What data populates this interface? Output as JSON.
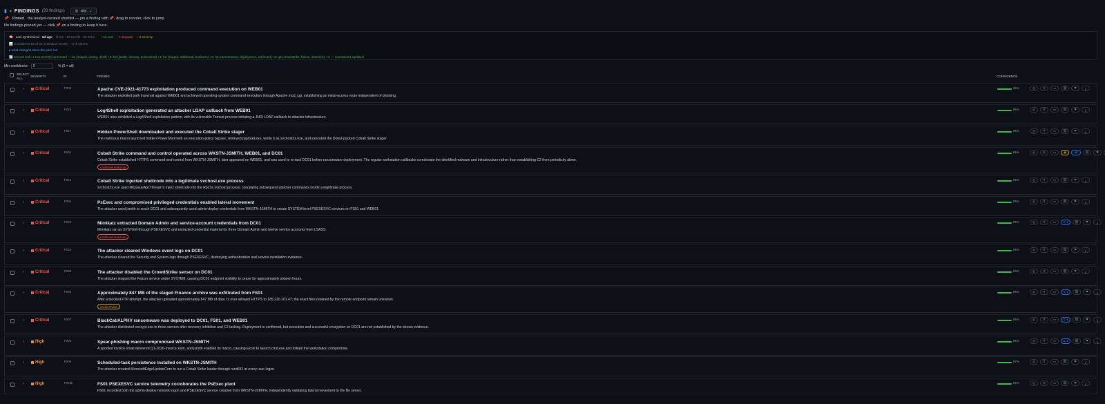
{
  "header": {
    "title": "FINDINGS",
    "count": "(33 findings)",
    "filter": "any"
  },
  "pinned": {
    "label": "Pinned",
    "help": "the analyst-curated shortlist — pin a finding with 📌, drag to reorder, click to jump",
    "empty": "No findings pinned yet — click 📌 on a finding to keep it here."
  },
  "synth": {
    "last_prefix": "Last synthesized",
    "last_ago": "6d ago",
    "stats": "5m · 83 events · 35 IOCs",
    "new": "+12 new",
    "dropped": "−7 dropped",
    "severity": "↕ 3 severity",
    "considered": "Considered 83 of 83 in-window events · ~17k tokens",
    "changed": "what changed since the prior run",
    "second_look": "second look: 4 raw event(s) promoted — h1 (staged, during, dcOf) +2; h2 (jsmith, already, possessed) +4; h3 (staged, additional, business) +2; h5 (ransomware, deployment, achieved) +2; q3 (crowdstrike, falcon, detection) +2 — conclusions updated"
  },
  "minconf": {
    "label": "Min confidence:",
    "value": "0",
    "hint": "% (0 = all)"
  },
  "columns": {
    "select_all": "SELECT ALL",
    "severity": "SEVERITY",
    "id": "ID",
    "finding": "FINDING",
    "confidence": "CONFIDENCE"
  },
  "colors": {
    "critical": "#f85149",
    "high": "#f0883e",
    "confidence": "#3fb950",
    "accent": "#58a6ff"
  },
  "findings": [
    {
      "severity": "Critical",
      "id": "F009",
      "title": "Apache CVE-2021-41773 exploitation produced command execution on WEB01",
      "desc": "The attacker exploited path traversal against WEB01 and achieved operating-system command execution through Apache mod_cgi, establishing an initial-access route independent of phishing.",
      "tag": "",
      "confidence": 0.96,
      "conf_label": "96%",
      "annot": false,
      "ctx": false
    },
    {
      "severity": "Critical",
      "id": "F016",
      "title": "Log4Shell exploitation generated an attacker LDAP callback from WEB01",
      "desc": "WEB01 also exhibited a Log4Shell exploitation pattern, with its vulnerable Tomcat process initiating a JNDI LDAP callback to attacker infrastructure.",
      "tag": "",
      "confidence": 0.96,
      "conf_label": "96%",
      "annot": false,
      "ctx": false
    },
    {
      "severity": "Critical",
      "id": "F017",
      "title": "Hidden PowerShell downloaded and executed the Cobalt Strike stager",
      "desc": "The malicious macro launched hidden PowerShell with an execution-policy bypass, retrieved payload.exe, wrote it as svchost32.exe, and executed the Donut-packed Cobalt Strike stager.",
      "tag": "",
      "confidence": 0.95,
      "conf_label": "95%",
      "annot": false,
      "ctx": false
    },
    {
      "severity": "Critical",
      "id": "F001",
      "title": "Cobalt Strike command and control operated across WKSTN-JSMITH, WEB01, and DC01",
      "desc": "Cobalt Strike established HTTPS command-and-control from WKSTN-JSMITH, later appeared on WEB01, and was used to re-task DC01 before ransomware deployment. The regular workstation callbacks corroborate the identified malware and infrastructure rather than establishing C2 from periodicity alone.",
      "tag": "confirmed-malicious",
      "tag_kind": "malicious",
      "confidence": 0.95,
      "conf_label": "95%",
      "annot": true,
      "ctx": false
    },
    {
      "severity": "Critical",
      "id": "F013",
      "title": "Cobalt Strike injected shellcode into a legitimate svchost.exe process",
      "desc": "svchost32.exe used NtQueueApcThread to inject shellcode into the RpcSs svchost process, concealing subsequent attacker commands inside a legitimate process.",
      "tag": "",
      "confidence": 0.95,
      "conf_label": "95%",
      "annot": false,
      "ctx": false
    },
    {
      "severity": "Critical",
      "id": "F004",
      "title": "PsExec and compromised privileged credentials enabled lateral movement",
      "desc": "The attacker used jsmith to reach DC01 and subsequently used admin-deploy credentials from WKSTN-JSMITH to create SYSTEM-level PSEXESVC services on FS01 and WEB01.",
      "tag": "",
      "confidence": 0.95,
      "conf_label": "95%",
      "annot": false,
      "ctx": false
    },
    {
      "severity": "Critical",
      "id": "F002",
      "title": "Mimikatz extracted Domain Admin and service-account credentials from DC01",
      "desc": "Mimikatz ran as SYSTEM through PSEXESVC and extracted credential material for three Domain Admin and twelve service accounts from LSASS.",
      "tag": "confirmed-malicious",
      "tag_kind": "malicious",
      "confidence": 0.95,
      "conf_label": "95%",
      "annot": false,
      "ctx": true
    },
    {
      "severity": "Critical",
      "id": "F018",
      "title": "The attacker cleared Windows event logs on DC01",
      "desc": "The attacker cleared the Security and System logs through PSEXESVC, destroying authentication and service-installation evidence.",
      "tag": "",
      "confidence": 0.95,
      "conf_label": "95%",
      "annot": false,
      "ctx": false
    },
    {
      "severity": "Critical",
      "id": "F020",
      "title": "The attacker disabled the CrowdStrike sensor on DC01",
      "desc": "The attacker stopped the Falcon service under SYSTEM, causing DC01 endpoint visibility to cease for approximately sixteen hours.",
      "tag": "",
      "confidence": 0.95,
      "conf_label": "95%",
      "annot": false,
      "ctx": false
    },
    {
      "severity": "Critical",
      "id": "F005",
      "title": "Approximately 847 MB of the staged Finance archive was exfiltrated from FS01",
      "desc": "After a blocked FTP attempt, the attacker uploaded approximately 847 MB of data.7z over allowed HTTPS to 185.220.101.47; the exact files retained by the remote endpoint remain unknown.",
      "tag": "needs-review",
      "tag_kind": "review",
      "confidence": 0.95,
      "conf_label": "95%",
      "annot": false,
      "ctx": true
    },
    {
      "severity": "Critical",
      "id": "F007",
      "title": "BlackCat/ALPHV ransomware was deployed to DC01, FS01, and WEB01",
      "desc": "The attacker distributed encrypt.exe to three servers after recovery inhibition and C2 tasking. Deployment is confirmed, but execution and successful encryption on DC01 are not established by the shown evidence.",
      "tag": "",
      "confidence": 0.95,
      "conf_label": "95%",
      "annot": false,
      "ctx": true
    },
    {
      "severity": "High",
      "id": "F003",
      "title": "Spear-phishing macro compromised WKSTN-JSMITH",
      "desc": "A spoofed invoice email delivered Q1-2026-Invoice.xlsm, and jsmith enabled its macro, causing Excel to launch cmd.exe and initiate the workstation compromise.",
      "tag": "",
      "confidence": 0.96,
      "conf_label": "96%",
      "annot": false,
      "ctx": true
    },
    {
      "severity": "High",
      "id": "F006",
      "title": "Scheduled-task persistence installed on WKSTN-JSMITH",
      "desc": "The attacker created MicrosoftEdgeUpdateCore to run a Cobalt Strike loader through rundll32 at every user logon.",
      "tag": "",
      "confidence": 0.97,
      "conf_label": "97%",
      "annot": false,
      "ctx": false
    },
    {
      "severity": "High",
      "id": "F004b",
      "title": "FS01 PSEXESVC service telemetry corroborates the PsExec pivot",
      "desc": "FS01 recorded both the admin-deploy network logon and PSEXESVC service creation from WKSTN-JSMITH, independently validating lateral movement to the file server.",
      "tag": "",
      "confidence": 0.96,
      "conf_label": "96%",
      "annot": false,
      "ctx": false
    }
  ]
}
